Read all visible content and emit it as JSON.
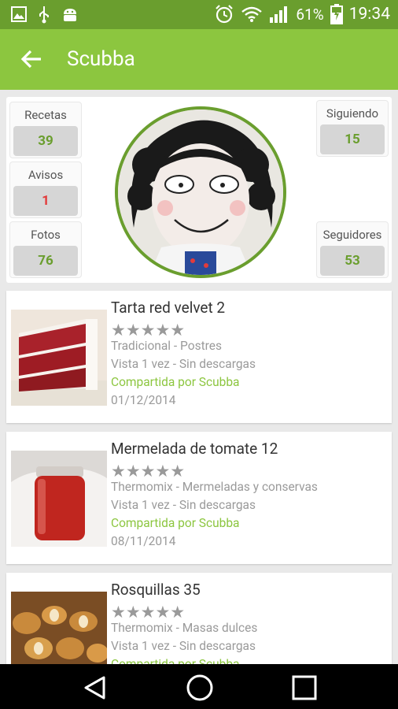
{
  "status_bar": {
    "battery": "61%",
    "time": "19:34"
  },
  "app_bar": {
    "title": "Scubba"
  },
  "stats": {
    "recetas": {
      "label": "Recetas",
      "value": "39"
    },
    "avisos": {
      "label": "Avisos",
      "value": "1"
    },
    "fotos": {
      "label": "Fotos",
      "value": "76"
    },
    "siguiendo": {
      "label": "Siguiendo",
      "value": "15"
    },
    "seguidores": {
      "label": "Seguidores",
      "value": "53"
    }
  },
  "recipes": [
    {
      "title": "Tarta red velvet 2",
      "category": "Tradicional",
      "subcategory": "Postres",
      "views": "Vista 1 vez",
      "downloads": "Sin descargas",
      "shared_by": "Compartida por Scubba",
      "date": "01/12/2014"
    },
    {
      "title": "Mermelada de tomate 12",
      "category": "Thermomix",
      "subcategory": "Mermeladas y conservas",
      "views": "Vista 1 vez",
      "downloads": "Sin descargas",
      "shared_by": "Compartida por Scubba",
      "date": "08/11/2014"
    },
    {
      "title": "Rosquillas 35",
      "category": "Thermomix",
      "subcategory": "Masas dulces",
      "views": "Vista 1 vez",
      "downloads": "Sin descargas",
      "shared_by": "Compartida por Scubba",
      "date": ""
    }
  ],
  "separator": " - ",
  "stars_glyph": "★★★★★",
  "colors": {
    "status_bar": "#6a9e2e",
    "app_bar": "#8cc63f",
    "accent_green": "#8cc63f",
    "alert_red": "#e23b3b"
  }
}
